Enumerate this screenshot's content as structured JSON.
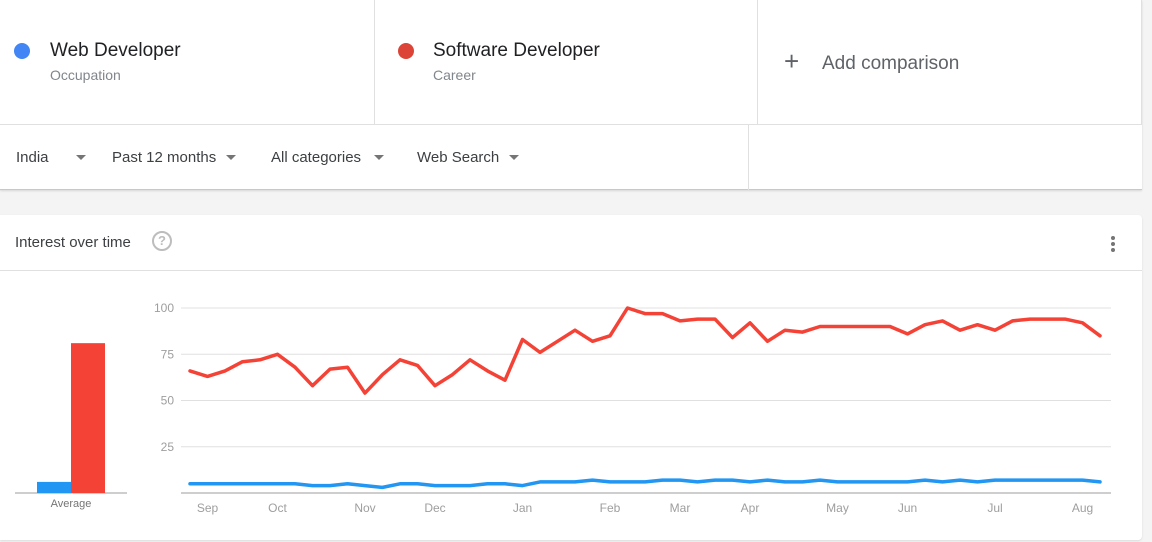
{
  "terms": [
    {
      "name": "Web Developer",
      "type": "Occupation",
      "color": "#4285f4"
    },
    {
      "name": "Software Developer",
      "type": "Career",
      "color": "#db4437"
    }
  ],
  "add_comparison": {
    "icon": "plus-icon",
    "label": "Add comparison"
  },
  "filters": [
    {
      "label": "India",
      "icon": "caret-down-icon"
    },
    {
      "label": "Past 12 months",
      "icon": "caret-down-icon"
    },
    {
      "label": "All categories",
      "icon": "caret-down-icon"
    },
    {
      "label": "Web Search",
      "icon": "caret-down-icon"
    }
  ],
  "card": {
    "title": "Interest over time",
    "help_icon": "help-circle-icon",
    "help_glyph": "?",
    "menu_icon": "more-vert-icon"
  },
  "chart_data": {
    "type": "line",
    "title": "Interest over time",
    "xlabel": "",
    "ylabel": "",
    "ylim": [
      0,
      100
    ],
    "yticks": [
      25,
      50,
      75,
      100
    ],
    "grid": true,
    "x_tick_labels": [
      "Sep",
      "Oct",
      "Nov",
      "Dec",
      "Jan",
      "Feb",
      "Mar",
      "Apr",
      "May",
      "Jun",
      "Jul",
      "Aug"
    ],
    "x_tick_positions": [
      1,
      5,
      10,
      14,
      19,
      24,
      28,
      32,
      37,
      41,
      46,
      51
    ],
    "series": [
      {
        "name": "Web Developer",
        "color": "#2196f3",
        "values": [
          5,
          5,
          5,
          5,
          5,
          5,
          5,
          4,
          4,
          5,
          4,
          3,
          5,
          5,
          4,
          4,
          4,
          5,
          5,
          4,
          6,
          6,
          6,
          7,
          6,
          6,
          6,
          7,
          7,
          6,
          7,
          7,
          6,
          7,
          6,
          6,
          7,
          6,
          6,
          6,
          6,
          6,
          7,
          6,
          7,
          6,
          7,
          7,
          7,
          7,
          7,
          7,
          6
        ]
      },
      {
        "name": "Software Developer",
        "color": "#f44336",
        "values": [
          66,
          63,
          66,
          71,
          72,
          75,
          68,
          58,
          67,
          68,
          54,
          64,
          72,
          69,
          58,
          64,
          72,
          66,
          61,
          83,
          76,
          82,
          88,
          82,
          85,
          100,
          97,
          97,
          93,
          94,
          94,
          84,
          92,
          82,
          88,
          87,
          90,
          90,
          90,
          90,
          90,
          86,
          91,
          93,
          88,
          91,
          88,
          93,
          94,
          94,
          94,
          92,
          85
        ]
      }
    ],
    "average": {
      "label": "Average",
      "values": [
        {
          "name": "Web Developer",
          "value": 6,
          "color": "#2196f3"
        },
        {
          "name": "Software Developer",
          "value": 81,
          "color": "#f44336"
        }
      ]
    }
  }
}
